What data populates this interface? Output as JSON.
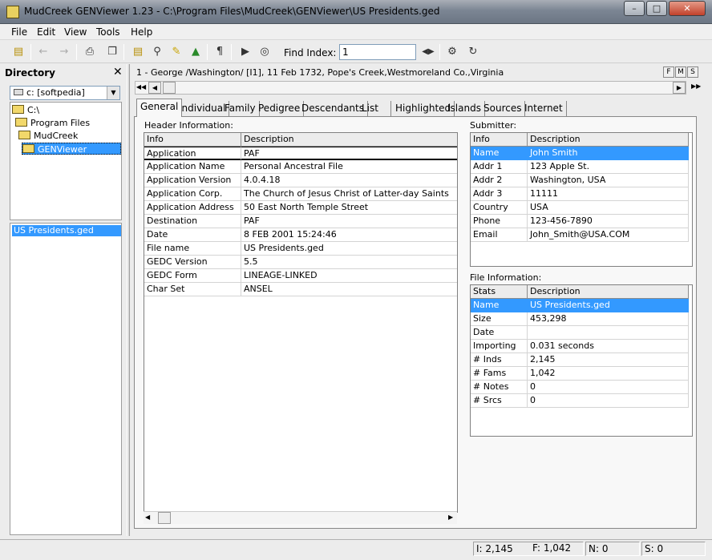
{
  "window": {
    "title": "MudCreek GENViewer 1.23 - C:\\Program Files\\MudCreek\\GENViewer\\US Presidents.ged",
    "minimize": "–",
    "maximize": "□",
    "close": "✕"
  },
  "menu": [
    "File",
    "Edit",
    "View",
    "Tools",
    "Help"
  ],
  "toolbar": {
    "find_label": "Find Index:",
    "find_value": "1"
  },
  "directory": {
    "title": "Directory",
    "close": "✕",
    "drive": "c: [softpedia]",
    "tree": [
      "C:\\",
      "Program Files",
      "MudCreek",
      "GENViewer"
    ],
    "files": [
      "US Presidents.ged"
    ]
  },
  "record": {
    "summary": "1 - George /Washington/ [I1], 11 Feb 1732, Pope's Creek,Westmoreland Co.,Virginia",
    "buttons": [
      "F",
      "M",
      "S"
    ]
  },
  "tabs": [
    "General",
    "Individual",
    "Family",
    "Pedigree",
    "Descendants",
    "List",
    "Highlighted",
    "Islands",
    "Sources",
    "Internet"
  ],
  "active_tab": "General",
  "header_info": {
    "label": "Header Information:",
    "columns": [
      "Info",
      "Description"
    ],
    "rows": [
      [
        "Application",
        "PAF"
      ],
      [
        "Application Name",
        "Personal Ancestral File"
      ],
      [
        "Application Version",
        "4.0.4.18"
      ],
      [
        "Application Corp.",
        "The Church of Jesus Christ of Latter-day Saints"
      ],
      [
        "Application Address",
        "50 East North Temple Street"
      ],
      [
        "Destination",
        "PAF"
      ],
      [
        "Date",
        "8 FEB 2001 15:24:46"
      ],
      [
        "File name",
        "US Presidents.ged"
      ],
      [
        "GEDC Version",
        "5.5"
      ],
      [
        "GEDC Form",
        "LINEAGE-LINKED"
      ],
      [
        "Char Set",
        "ANSEL"
      ]
    ]
  },
  "submitter": {
    "label": "Submitter:",
    "columns": [
      "Info",
      "Description"
    ],
    "rows": [
      [
        "Name",
        "John Smith"
      ],
      [
        "Addr 1",
        "123 Apple St."
      ],
      [
        "Addr 2",
        "Washington, USA"
      ],
      [
        "Addr 3",
        "11111"
      ],
      [
        "Country",
        "USA"
      ],
      [
        "Phone",
        "123-456-7890"
      ],
      [
        "Email",
        "John_Smith@USA.COM"
      ]
    ]
  },
  "file_info": {
    "label": "File Information:",
    "columns": [
      "Stats",
      "Description"
    ],
    "rows": [
      [
        "Name",
        "US Presidents.ged"
      ],
      [
        "Size",
        "453,298"
      ],
      [
        "Date",
        ""
      ],
      [
        "Importing",
        "0.031 seconds"
      ],
      [
        "# Inds",
        "2,145"
      ],
      [
        "# Fams",
        "1,042"
      ],
      [
        "# Notes",
        "0"
      ],
      [
        "# Srcs",
        "0"
      ]
    ]
  },
  "status": [
    "I: 2,145",
    "F: 1,042",
    "N: 0",
    "S: 0"
  ]
}
